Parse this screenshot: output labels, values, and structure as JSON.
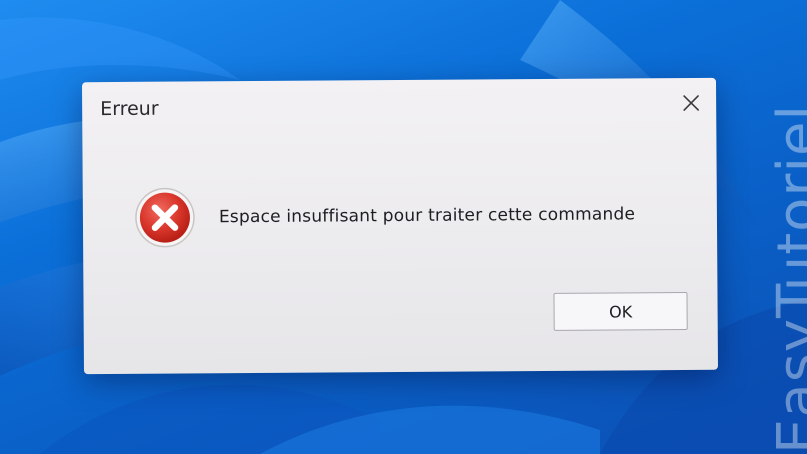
{
  "dialog": {
    "title": "Erreur",
    "message": "Espace insuffisant pour traiter cette commande",
    "ok_label": "OK",
    "close_icon": "close-icon",
    "status_icon": "error-icon",
    "status_color": "#d32f2f"
  },
  "watermark": {
    "text": "EasyTutoriel"
  },
  "colors": {
    "desktop_blue": "#0b6fd8",
    "dialog_bg": "#efeef1"
  }
}
